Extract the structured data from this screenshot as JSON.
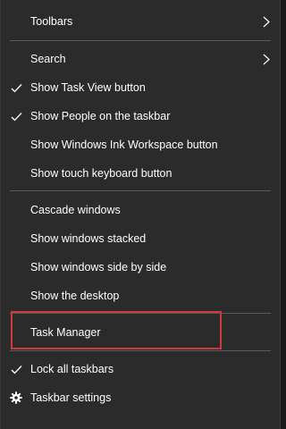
{
  "menu": {
    "items": {
      "toolbars": {
        "label": "Toolbars"
      },
      "search": {
        "label": "Search"
      },
      "show_task_view": {
        "label": "Show Task View button",
        "checked": true
      },
      "show_people": {
        "label": "Show People on the taskbar",
        "checked": true
      },
      "show_ink": {
        "label": "Show Windows Ink Workspace button"
      },
      "show_touch_keyboard": {
        "label": "Show touch keyboard button"
      },
      "cascade": {
        "label": "Cascade windows"
      },
      "stacked": {
        "label": "Show windows stacked"
      },
      "side_by_side": {
        "label": "Show windows side by side"
      },
      "desktop": {
        "label": "Show the desktop"
      },
      "task_manager": {
        "label": "Task Manager"
      },
      "lock_taskbars": {
        "label": "Lock all taskbars",
        "checked": true
      },
      "taskbar_settings": {
        "label": "Taskbar settings",
        "icon": "gear-icon"
      }
    }
  },
  "colors": {
    "background": "#2b2b2b",
    "text": "#ffffff",
    "separator": "#5b5b5b",
    "highlight_border": "#d0393b"
  }
}
